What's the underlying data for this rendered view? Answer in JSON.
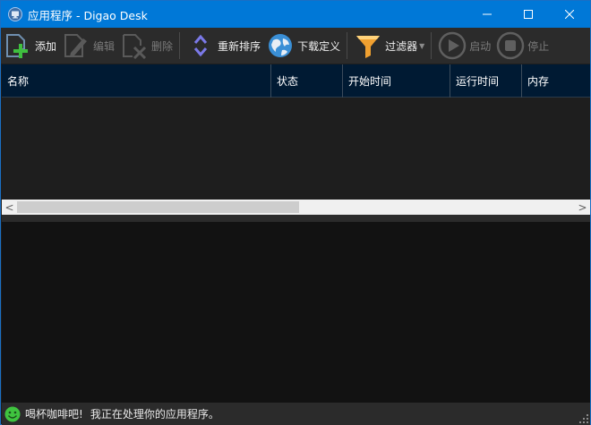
{
  "window": {
    "title": "应用程序 - Digao Desk",
    "controls": {
      "minimize": "—",
      "maximize": "☐",
      "close": "✕"
    }
  },
  "toolbar": {
    "items": [
      {
        "label": "添加",
        "icon": "add-icon",
        "enabled": true
      },
      {
        "label": "编辑",
        "icon": "edit-pencil-icon",
        "enabled": false
      },
      {
        "label": "删除",
        "icon": "delete-icon",
        "enabled": false
      },
      {
        "label": "重新排序",
        "icon": "reorder-arrows-icon",
        "enabled": true
      },
      {
        "label": "下载定义",
        "icon": "globe-icon",
        "enabled": true
      },
      {
        "label": "过滤器",
        "icon": "funnel-filter-icon",
        "enabled": true,
        "has_dropdown": true
      },
      {
        "label": "启动",
        "icon": "play-icon",
        "enabled": false
      },
      {
        "label": "停止",
        "icon": "stop-icon",
        "enabled": false
      }
    ]
  },
  "grid": {
    "columns": [
      "名称",
      "状态",
      "开始时间",
      "运行时间",
      "内存"
    ],
    "rows": []
  },
  "scrollbar": {
    "left": "<",
    "right": ">"
  },
  "status": {
    "message1": "喝杯咖啡吧!",
    "message2": "我正在处理你的应用程序。",
    "icon": "smiley-icon"
  },
  "colors": {
    "titlebar": "#0078d7",
    "toolbar": "#2b2b2b",
    "header": "#001a33",
    "body": "#1e1e1e",
    "log": "#121212"
  }
}
